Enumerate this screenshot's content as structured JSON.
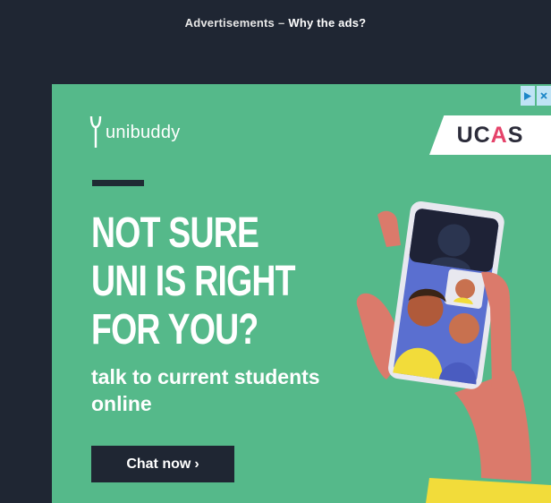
{
  "top_bar": {
    "advertisement_label": "Advertisements",
    "separator": "–",
    "why_link": "Why the ads?"
  },
  "ad": {
    "background_color": "#55b98a",
    "adchoices_icons": [
      "play-triangle-icon",
      "close-x-icon"
    ],
    "brand_name": "unibuddy",
    "brand_logo_icon": "tuning-fork-icon",
    "partner_logo": {
      "text_start": "UC",
      "text_accent": "A",
      "text_end": "S",
      "accent_color": "#e5436a"
    },
    "headline_lines": [
      "NOT SURE",
      "UNI IS RIGHT",
      "FOR YOU?"
    ],
    "subline": "talk to current students online",
    "cta": {
      "label": "Chat now",
      "arrow": "›"
    },
    "illustration": "hand-holding-phone-video-call-illustration"
  }
}
